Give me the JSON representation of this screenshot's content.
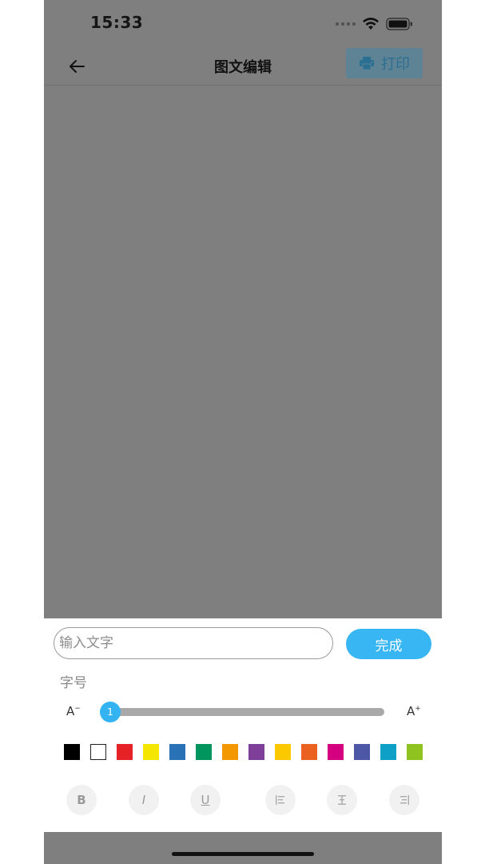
{
  "status": {
    "time": "15:33"
  },
  "header": {
    "title": "图文编辑",
    "print_label": "打印"
  },
  "editor": {
    "input_placeholder": "输入文字",
    "input_value": "",
    "done_label": "完成",
    "font_size_label": "字号",
    "decrease_label": "A",
    "increase_label": "A",
    "font_size_value": "1",
    "font_size_fraction": 0.0
  },
  "colors": [
    "#000000",
    "#ffffff",
    "#e52226",
    "#f4e600",
    "#2972b6",
    "#00955c",
    "#f39800",
    "#7d3f98",
    "#fcc800",
    "#eb6120",
    "#d5007f",
    "#4e57a5",
    "#0ea0c5",
    "#8fc31f"
  ],
  "format": {
    "bold": "B",
    "italic": "I",
    "underline": "U"
  }
}
